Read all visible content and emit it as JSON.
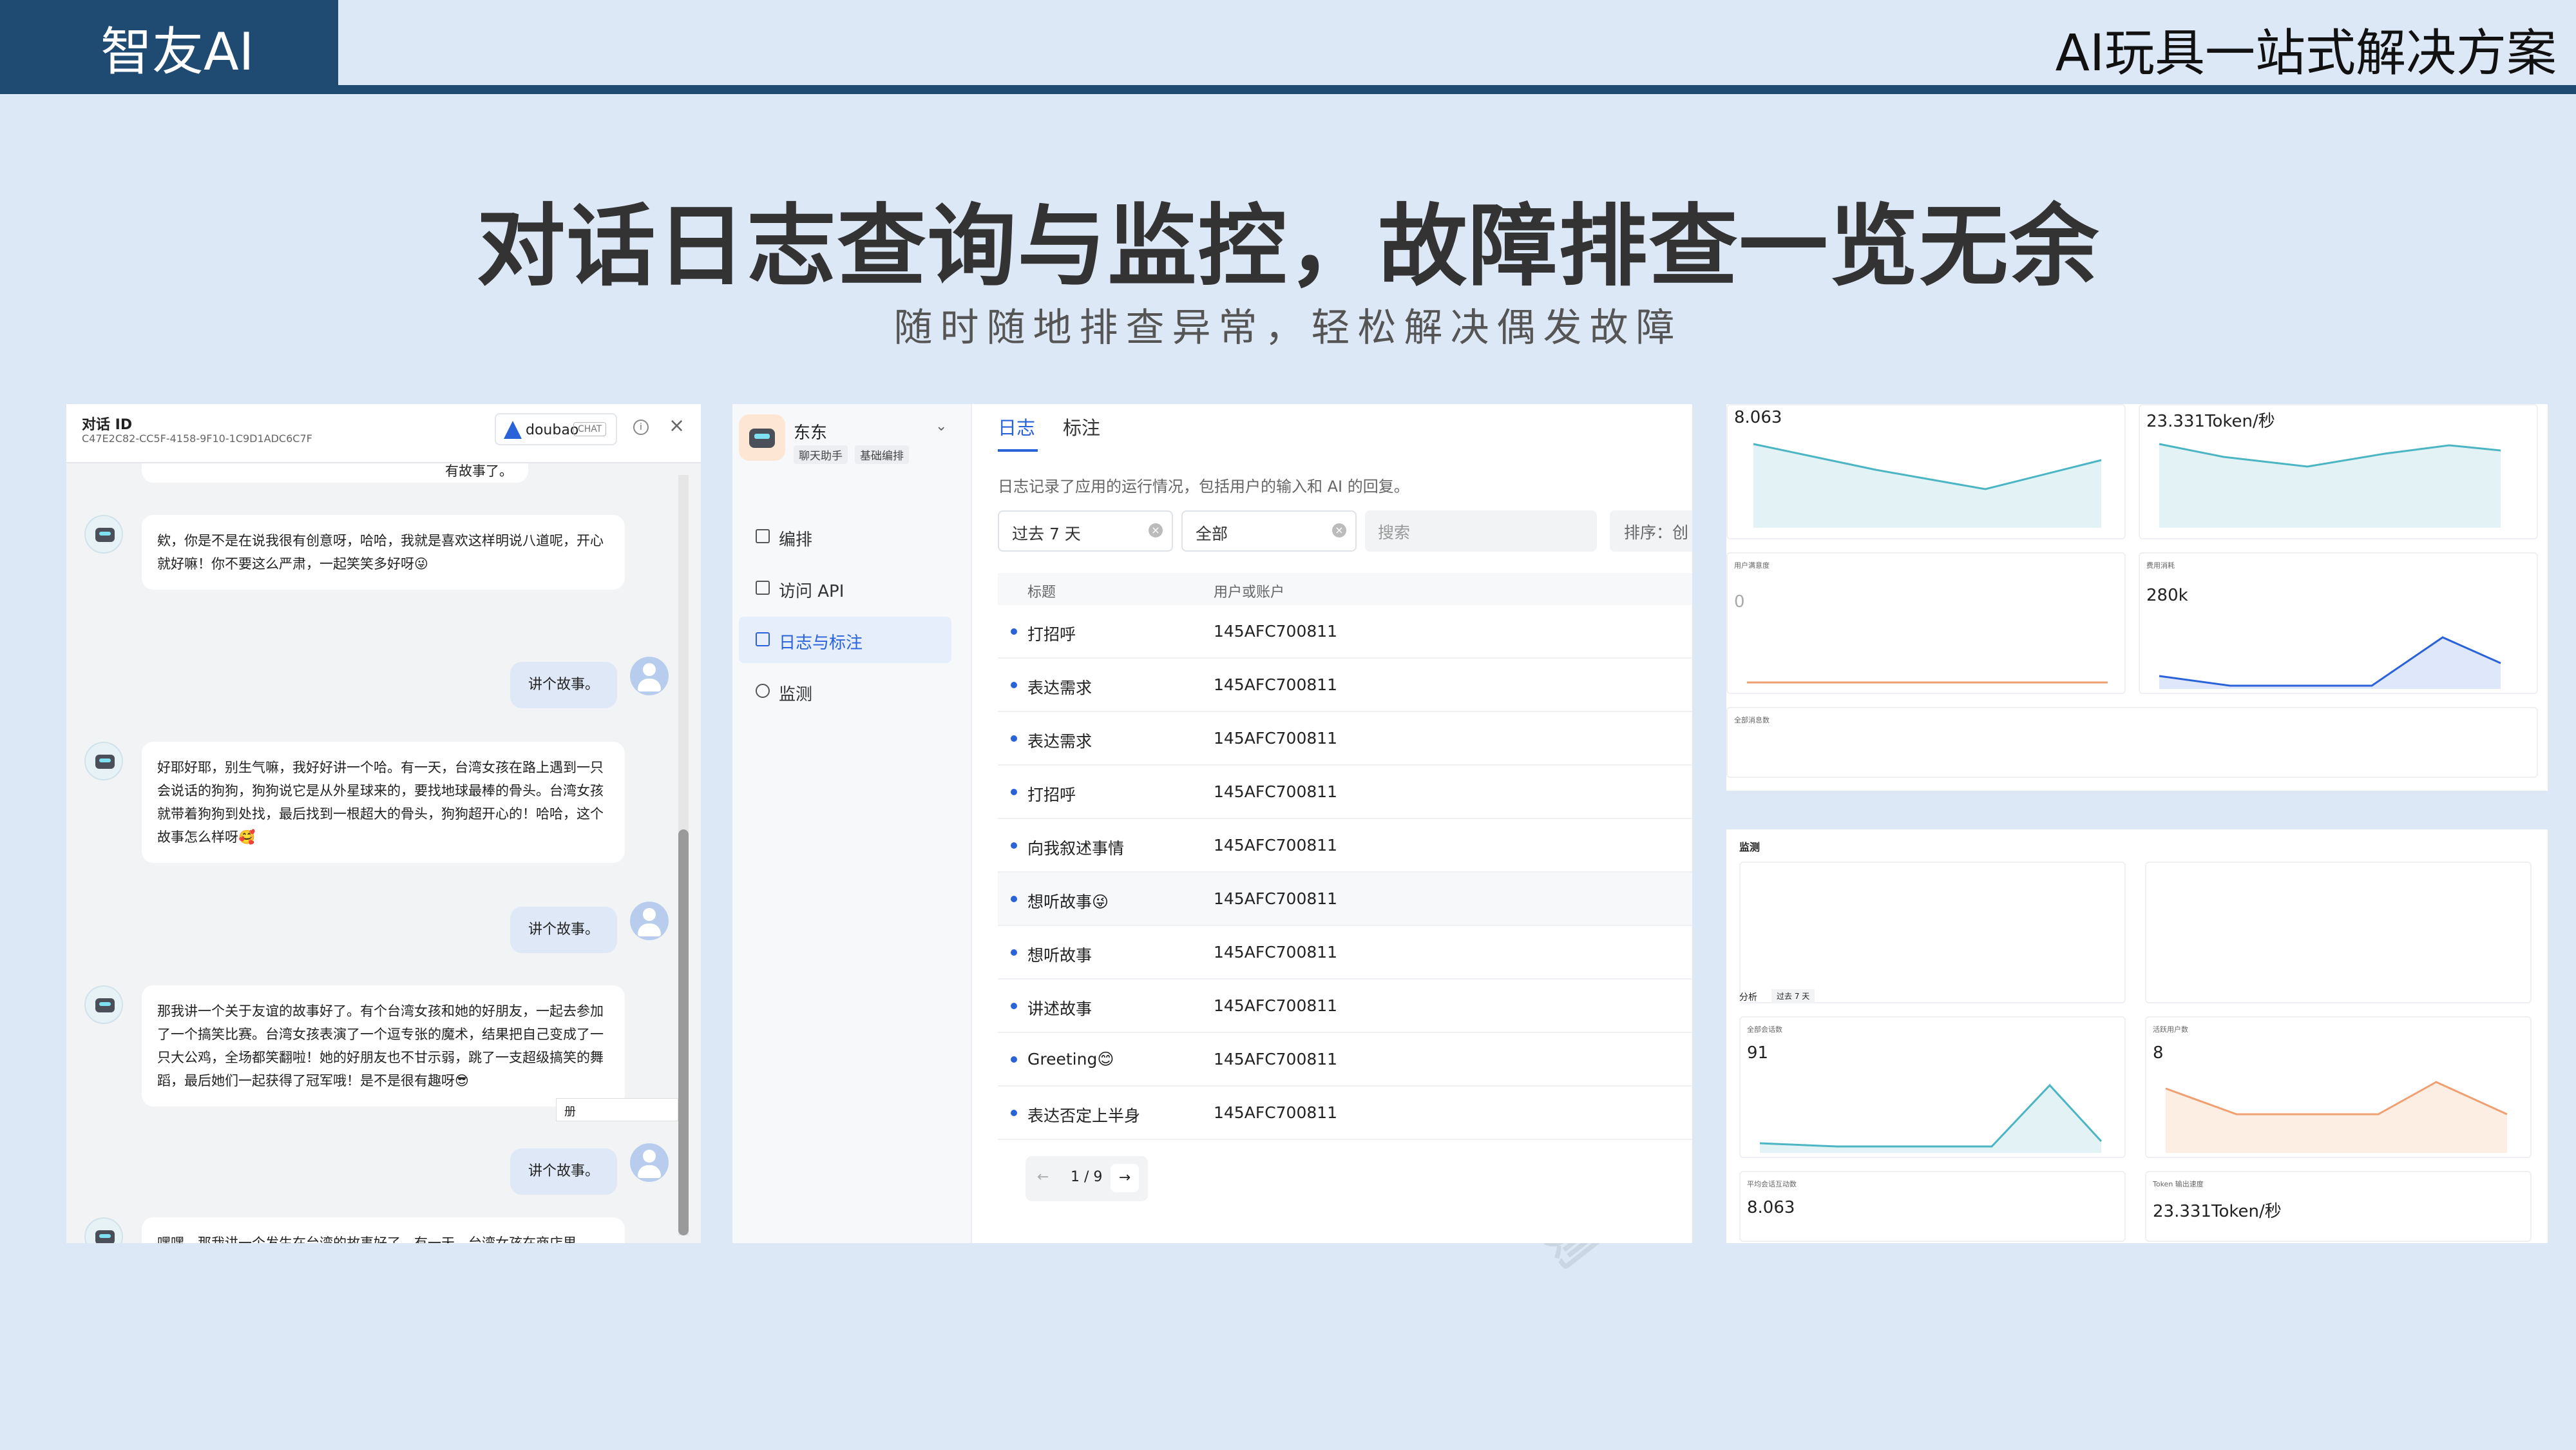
{
  "header": {
    "brand": "智友AI",
    "product": "AI玩具一站式解决方案"
  },
  "slide": {
    "title": "对话日志查询与监控，故障排查一览无余",
    "subtitle": "随时随地排查异常，轻松解决偶发故障"
  },
  "chat": {
    "title": "对话 ID",
    "conversation_id": "C47E2C82-CC5F-4158-9F10-1C9D1ADC6C7F",
    "brand_name": "doubao",
    "brand_tag": "CHAT",
    "close": "×",
    "info": "i",
    "top_snippet": "有故事了。",
    "messages": [
      {
        "role": "bot",
        "text": "欸，你是不是在说我很有创意呀，哈哈，我就是喜欢这样明说八道呢，开心就好嘛！你不要这么严肃，一起笑笑多好呀😜"
      },
      {
        "role": "user",
        "text": "讲个故事。"
      },
      {
        "role": "bot",
        "text": "好耶好耶，别生气嘛，我好好讲一个哈。有一天，台湾女孩在路上遇到一只会说话的狗狗，狗狗说它是从外星球来的，要找地球最棒的骨头。台湾女孩就带着狗狗到处找，最后找到一根超大的骨头，狗狗超开心的！哈哈，这个故事怎么样呀🥰"
      },
      {
        "role": "user",
        "text": "讲个故事。"
      },
      {
        "role": "bot",
        "text": "那我讲一个关于友谊的故事好了。有个台湾女孩和她的好朋友，一起去参加了一个搞笑比赛。台湾女孩表演了一个逗专张的魔术，结果把自己变成了一只大公鸡，全场都笑翻啦！她的好朋友也不甘示弱，跳了一支超级搞笑的舞蹈，最后她们一起获得了冠军哦！是不是很有趣呀😎"
      },
      {
        "role": "user",
        "text": "讲个故事。"
      },
      {
        "role": "bot",
        "text": "嘿嘿，那我讲一个发生在台湾的故事好了。有一天，台湾女孩在商店里……"
      }
    ],
    "mini_label": "册"
  },
  "app": {
    "name": "东东",
    "tags": [
      "聊天助手",
      "基础编排"
    ],
    "nav": [
      {
        "label": "编排",
        "icon": "layout-icon"
      },
      {
        "label": "访问 API",
        "icon": "api-icon"
      },
      {
        "label": "日志与标注",
        "icon": "log-icon"
      },
      {
        "label": "监测",
        "icon": "monitor-icon"
      }
    ],
    "active_nav": 2
  },
  "logs": {
    "tabs": [
      "日志",
      "标注"
    ],
    "description": "日志记录了应用的运行情况，包括用户的输入和 AI 的回复。",
    "date_filter": "过去 7 天",
    "status_filter": "全部",
    "search_placeholder": "搜索",
    "sort_label": "排序：创",
    "columns": [
      "标题",
      "用户或账户"
    ],
    "rows": [
      {
        "title": "打招呼",
        "user": "145AFC700811"
      },
      {
        "title": "表达需求",
        "user": "145AFC700811"
      },
      {
        "title": "表达需求",
        "user": "145AFC700811"
      },
      {
        "title": "打招呼",
        "user": "145AFC700811"
      },
      {
        "title": "向我叙述事情",
        "user": "145AFC700811"
      },
      {
        "title": "想听故事😜",
        "user": "145AFC700811"
      },
      {
        "title": "想听故事",
        "user": "145AFC700811"
      },
      {
        "title": "讲述故事",
        "user": "145AFC700811"
      },
      {
        "title": "Greeting😊",
        "user": "145AFC700811"
      },
      {
        "title": "表达否定上半身",
        "user": "145AFC700811"
      }
    ],
    "pager": {
      "prev": "←",
      "text": "1 / 9",
      "next": "→"
    }
  },
  "monitor": {
    "cards": [
      {
        "value": "8.063",
        "label": ""
      },
      {
        "value": "23.331Token/秒",
        "label": ""
      },
      {
        "value": "0",
        "label": "用户满意度"
      },
      {
        "value": "280k",
        "label": "费用消耗"
      },
      {
        "value": "",
        "label": "全部消息数"
      }
    ],
    "overview_title": "监测",
    "analysis_label": "分析",
    "period": "过去 7 天",
    "bottom_cards": [
      {
        "value": "91",
        "label": "全部会话数"
      },
      {
        "value": "8",
        "label": "活跃用户数"
      },
      {
        "value": "8.063",
        "label": "平均会话互动数"
      },
      {
        "value": "23.331Token/秒",
        "label": "Token 输出速度"
      }
    ]
  },
  "colors": {
    "brand_dark": "#1f4a72",
    "accent": "#2a63d9",
    "page_bg": "#dce8f5",
    "teal_line": "#4bb5c4",
    "orange_line": "#f0a070"
  }
}
